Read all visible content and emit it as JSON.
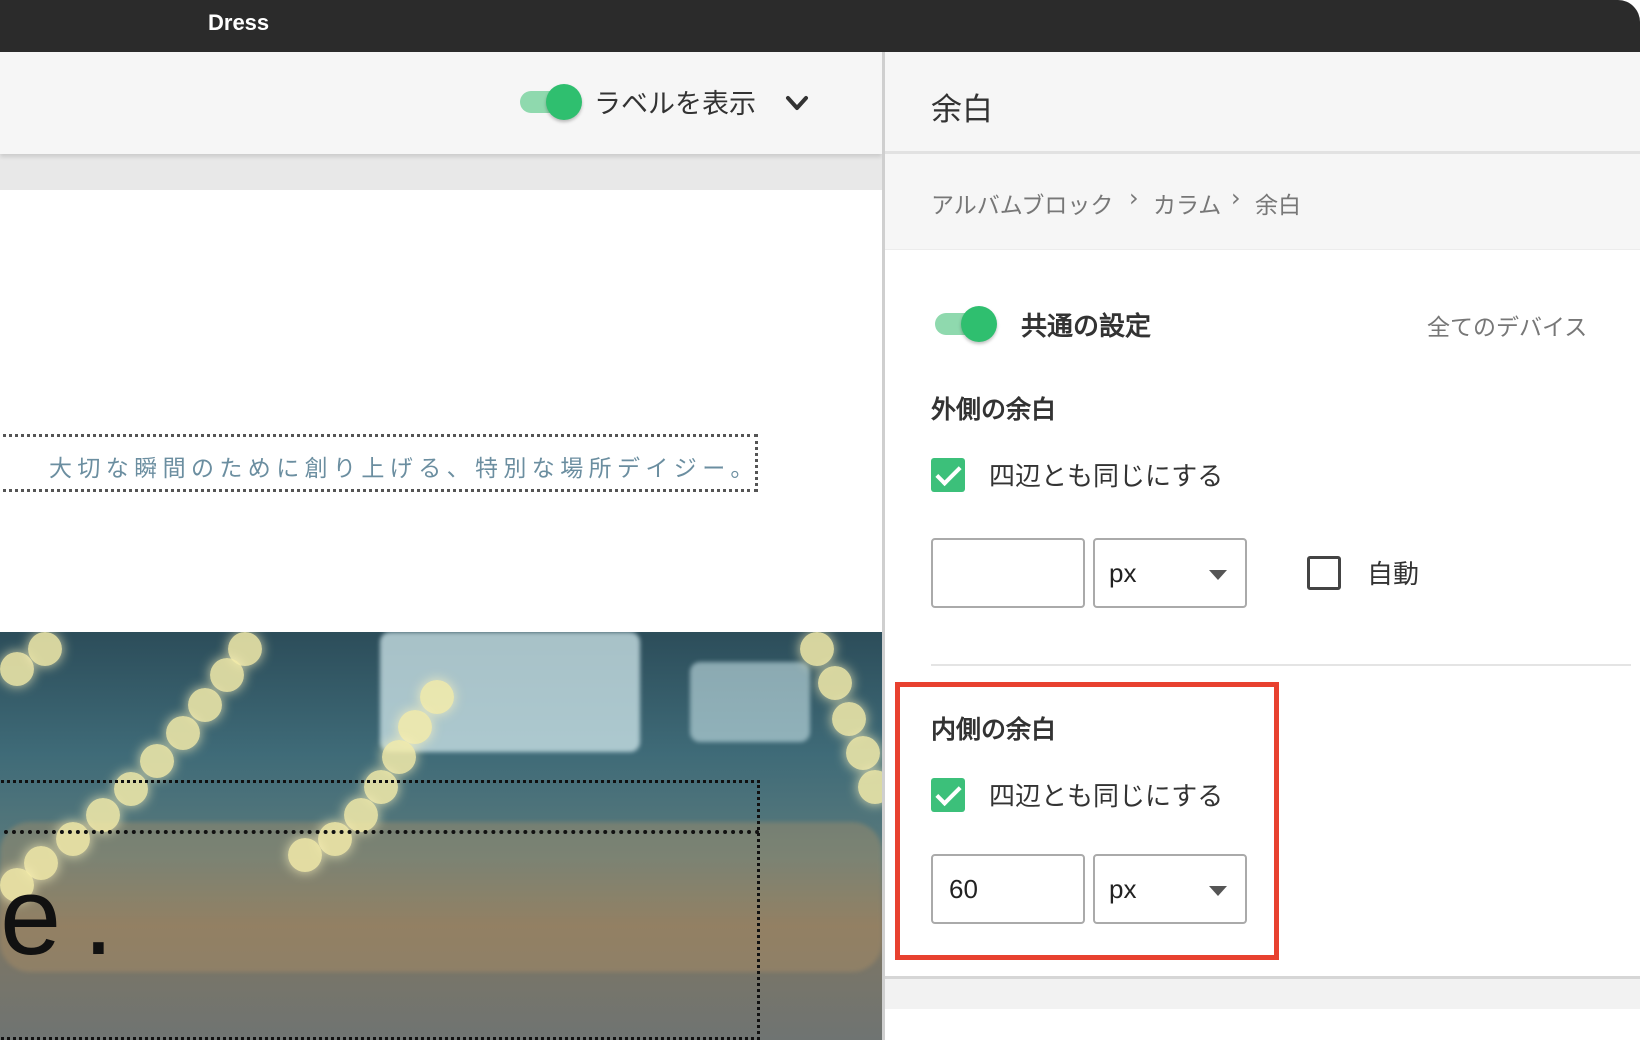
{
  "app": {
    "title": "Dress"
  },
  "left": {
    "toolbar": {
      "show_labels_label": "ラベルを表示",
      "show_labels_on": true
    },
    "caption": "大切な瞬間のために創り上げる、特別な場所デイジー。",
    "big_text": "e."
  },
  "panel": {
    "title": "余白",
    "breadcrumb": [
      "アルバムブロック",
      "カラム",
      "余白"
    ],
    "breadcrumb_separator": "›",
    "common": {
      "label": "共通の設定",
      "enabled": true,
      "devices": "全てのデバイス"
    },
    "outer": {
      "title": "外側の余白",
      "same_all_sides": {
        "label": "四辺とも同じにする",
        "checked": true
      },
      "value": "",
      "unit": "px",
      "auto": {
        "label": "自動",
        "checked": false
      }
    },
    "inner": {
      "title": "内側の余白",
      "same_all_sides": {
        "label": "四辺とも同じにする",
        "checked": true
      },
      "value": "60",
      "unit": "px"
    }
  },
  "colors": {
    "accent_green": "#2fbf6f",
    "highlight_red": "#e8412f",
    "topbar": "#2b2b2b"
  }
}
